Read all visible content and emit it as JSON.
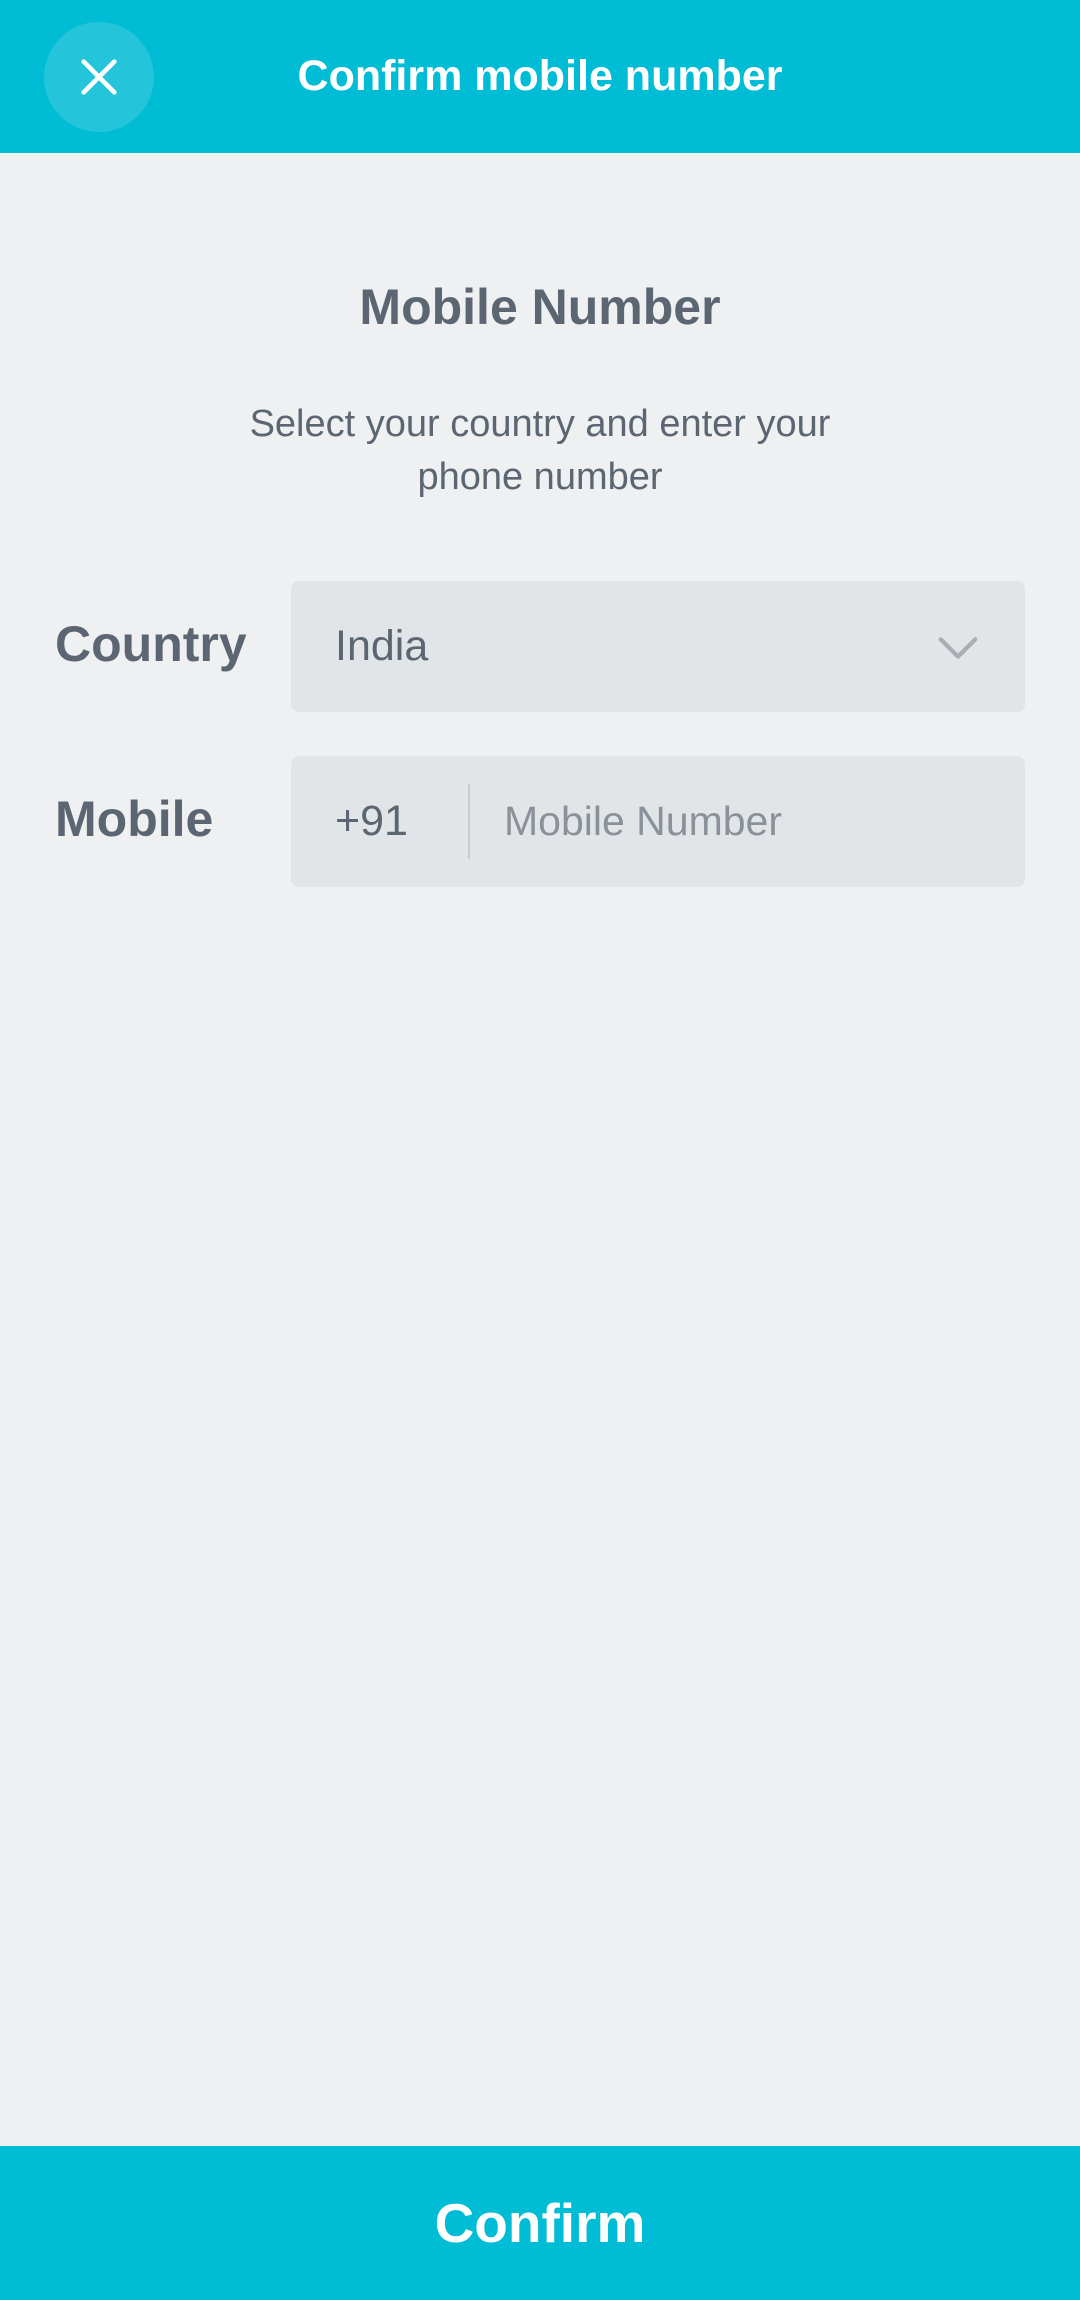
{
  "header": {
    "title": "Confirm mobile number",
    "close_icon": "close-icon",
    "background_color": "#00bcd4"
  },
  "main": {
    "title": "Mobile Number",
    "subtitle": "Select your country and enter your phone number"
  },
  "form": {
    "country": {
      "label": "Country",
      "value": "India",
      "icon": "chevron-down-icon"
    },
    "mobile": {
      "label": "Mobile",
      "dial_code": "+91",
      "value": "",
      "placeholder": "Mobile Number"
    }
  },
  "footer": {
    "confirm_label": "Confirm",
    "background_color": "#00bcd4"
  }
}
